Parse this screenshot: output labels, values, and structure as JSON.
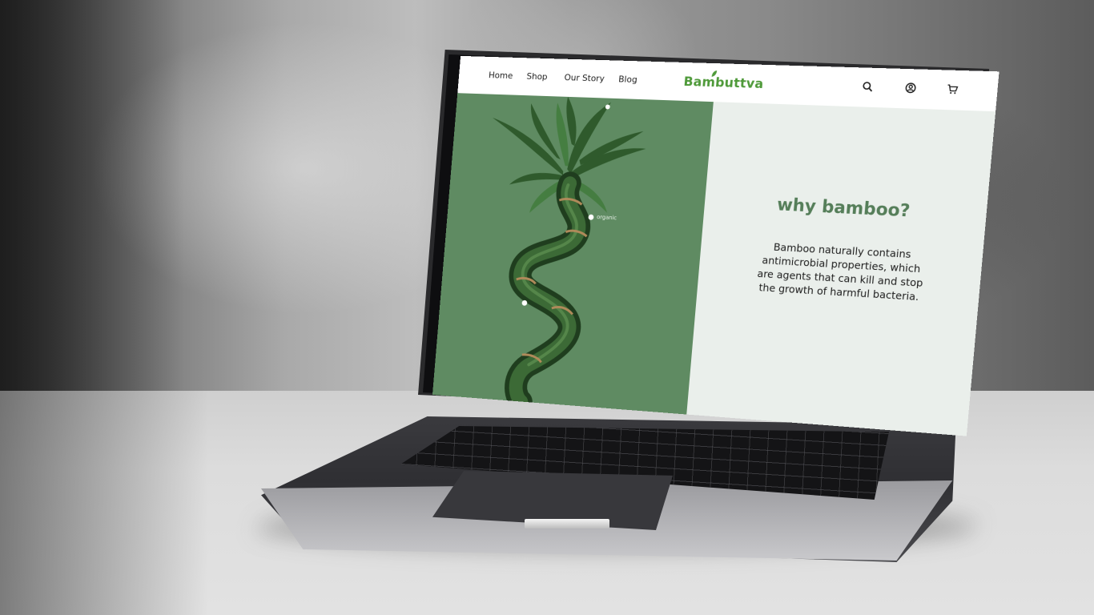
{
  "nav": {
    "links": [
      "Home",
      "Shop",
      "Our Story",
      "Blog"
    ],
    "brand": "Bambuttva",
    "icons": [
      "search-icon",
      "account-icon",
      "cart-icon"
    ]
  },
  "hero": {
    "tag": "organic",
    "title": "why bamboo?",
    "body": "Bamboo naturally contains antimicrobial properties, which are agents that can kill and stop the growth of harmful bacteria."
  },
  "colors": {
    "brand_green": "#4f9a3a",
    "hero_green": "#5f8b62",
    "title_green": "#557e59",
    "panel_bg": "#eaefeb"
  }
}
